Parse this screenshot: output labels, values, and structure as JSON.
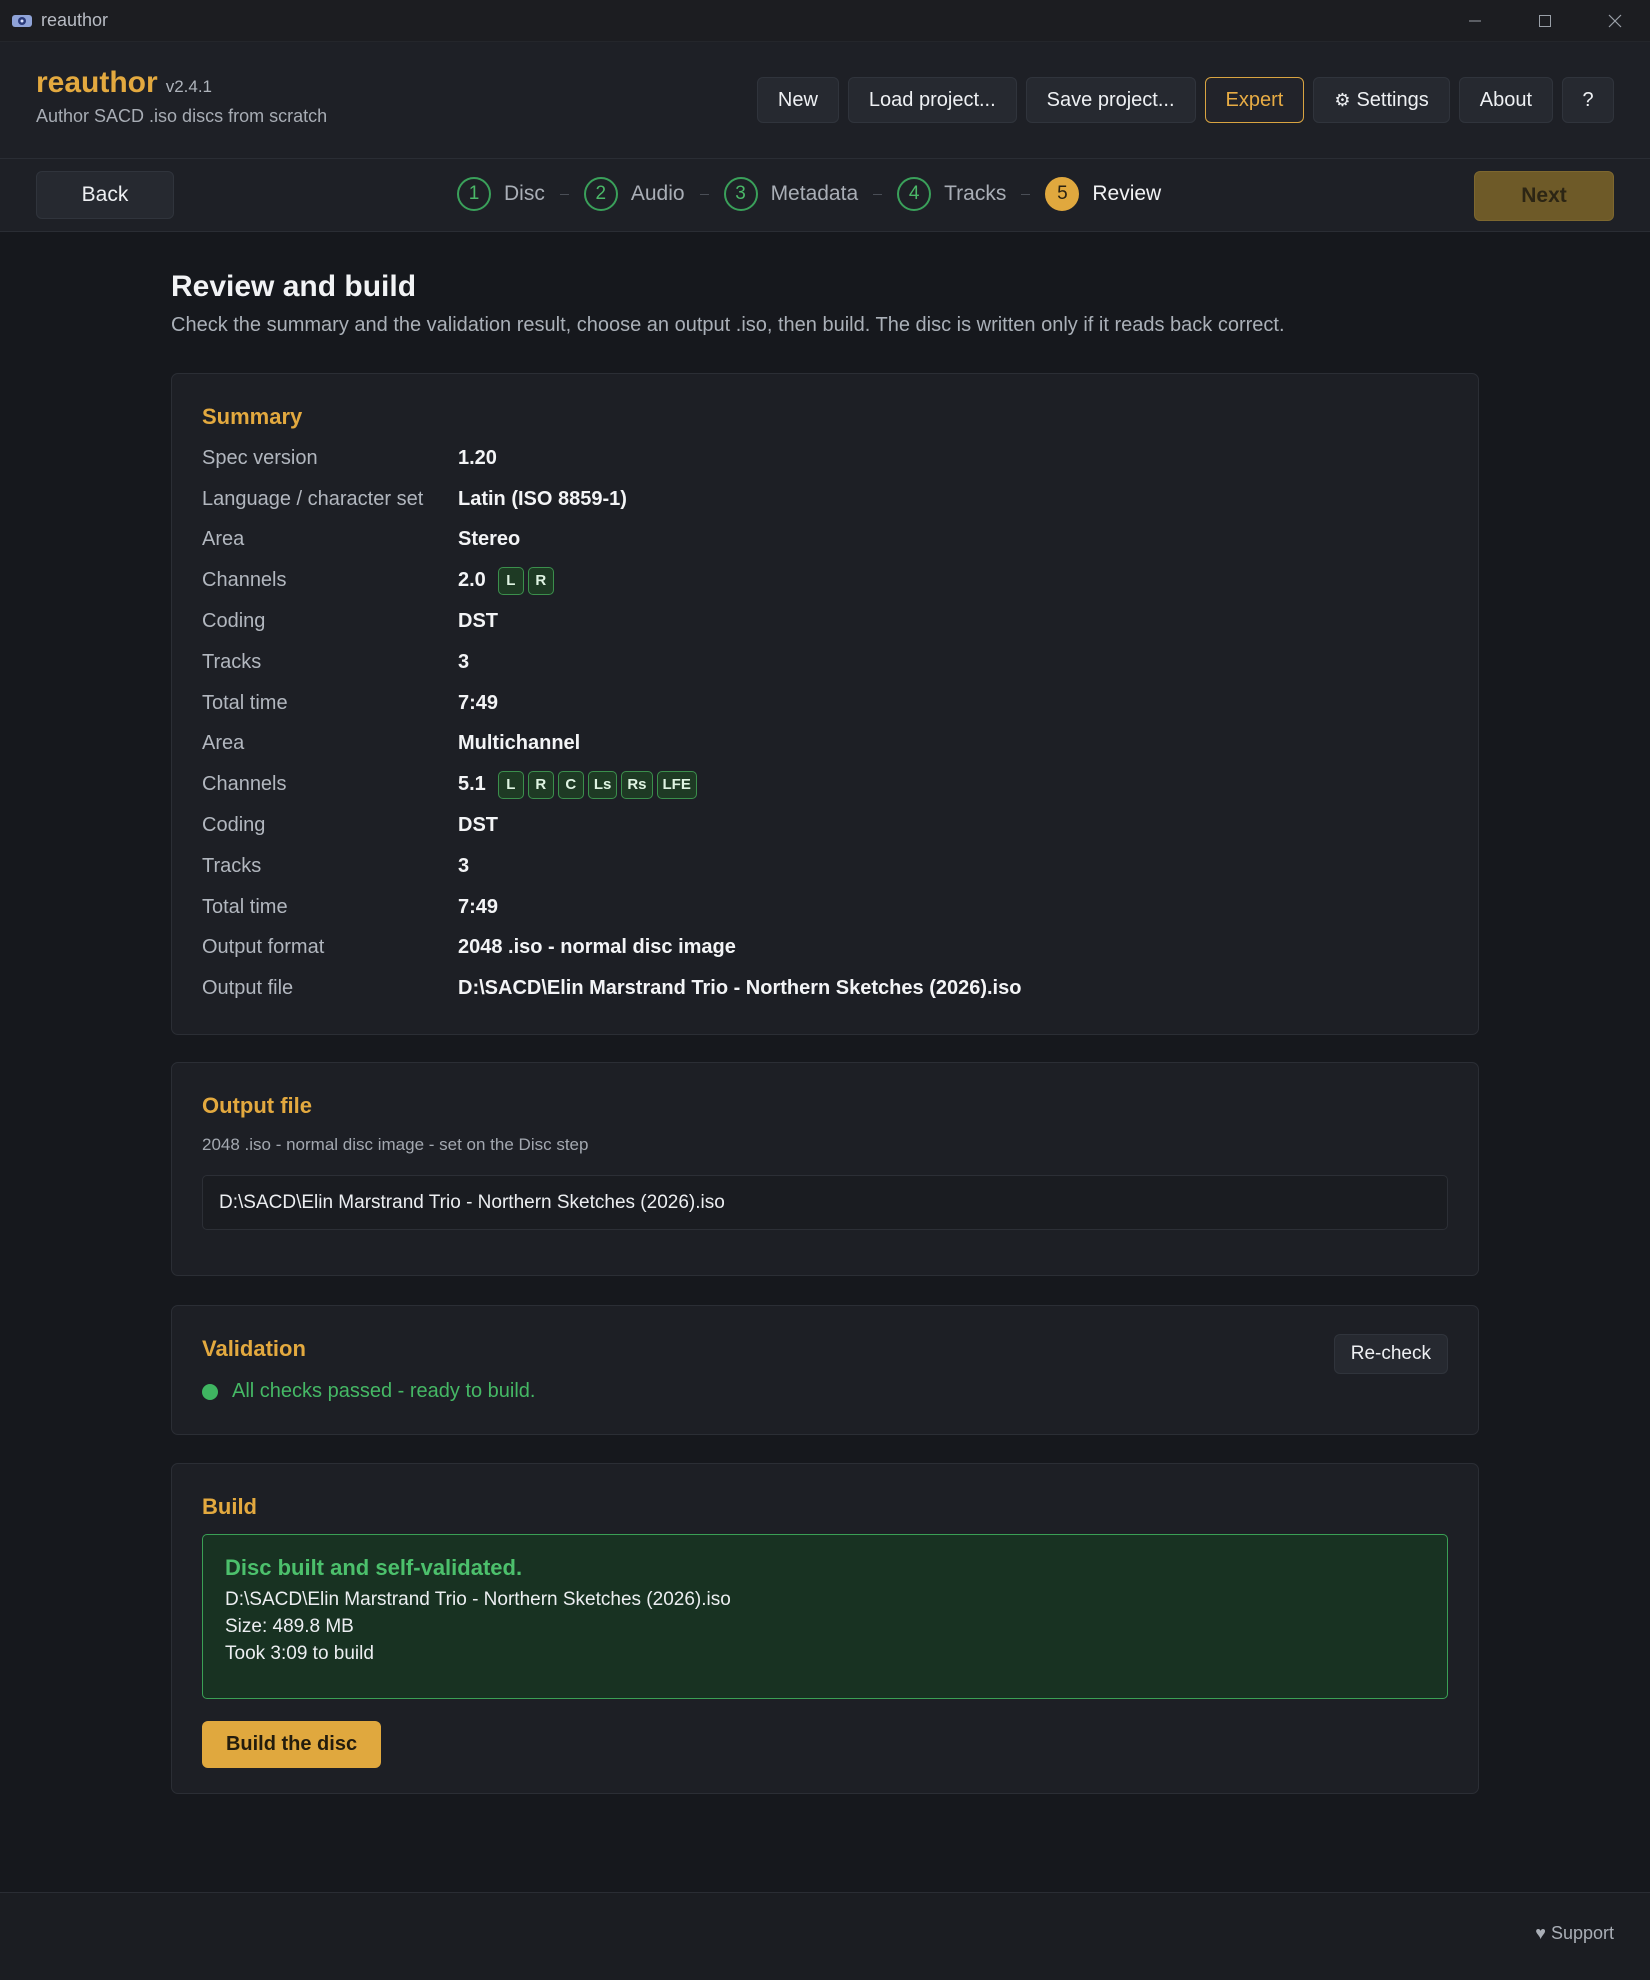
{
  "window": {
    "title": "reauthor"
  },
  "header": {
    "app_name": "reauthor",
    "version": "v2.4.1",
    "tagline": "Author SACD .iso discs from scratch",
    "buttons": {
      "new": "New",
      "load": "Load project...",
      "save": "Save project...",
      "expert": "Expert",
      "settings": "Settings",
      "about": "About",
      "help": "?"
    }
  },
  "nav": {
    "back": "Back",
    "next": "Next",
    "steps": [
      {
        "num": "1",
        "label": "Disc"
      },
      {
        "num": "2",
        "label": "Audio"
      },
      {
        "num": "3",
        "label": "Metadata"
      },
      {
        "num": "4",
        "label": "Tracks"
      },
      {
        "num": "5",
        "label": "Review"
      }
    ]
  },
  "page": {
    "title": "Review and build",
    "subtitle": "Check the summary and the validation result, choose an output .iso, then build. The disc is written only if it reads back correct."
  },
  "summary": {
    "heading": "Summary",
    "rows": [
      {
        "key": "Spec version",
        "value": "1.20"
      },
      {
        "key": "Language / character set",
        "value": "Latin (ISO 8859-1)"
      },
      {
        "key": "Area",
        "value": "Stereo"
      },
      {
        "key": "Channels",
        "value": "2.0",
        "chips": [
          "L",
          "R"
        ]
      },
      {
        "key": "Coding",
        "value": "DST"
      },
      {
        "key": "Tracks",
        "value": "3"
      },
      {
        "key": "Total time",
        "value": "7:49"
      },
      {
        "key": "Area",
        "value": "Multichannel"
      },
      {
        "key": "Channels",
        "value": "5.1",
        "chips": [
          "L",
          "R",
          "C",
          "Ls",
          "Rs",
          "LFE"
        ]
      },
      {
        "key": "Coding",
        "value": "DST"
      },
      {
        "key": "Tracks",
        "value": "3"
      },
      {
        "key": "Total time",
        "value": "7:49"
      },
      {
        "key": "Output format",
        "value": "2048 .iso - normal disc image"
      },
      {
        "key": "Output file",
        "value": "D:\\SACD\\Elin Marstrand Trio - Northern Sketches (2026).iso"
      }
    ]
  },
  "output_file": {
    "heading": "Output file",
    "note": "2048 .iso - normal disc image - set on the Disc step",
    "value": "D:\\SACD\\Elin Marstrand Trio - Northern Sketches (2026).iso"
  },
  "validation": {
    "heading": "Validation",
    "status": "All checks passed - ready to build.",
    "recheck": "Re-check",
    "status_color": "#3fb561"
  },
  "build": {
    "heading": "Build",
    "result_title": "Disc built and self-validated.",
    "result_path": "D:\\SACD\\Elin Marstrand Trio - Northern Sketches (2026).iso",
    "result_size": "Size: 489.8 MB",
    "result_time": "Took 3:09 to build",
    "button": "Build the disc"
  },
  "footer": {
    "support": "Support"
  },
  "colors": {
    "accent": "#e0a83e",
    "success": "#3fb561",
    "background": "#16181d"
  }
}
